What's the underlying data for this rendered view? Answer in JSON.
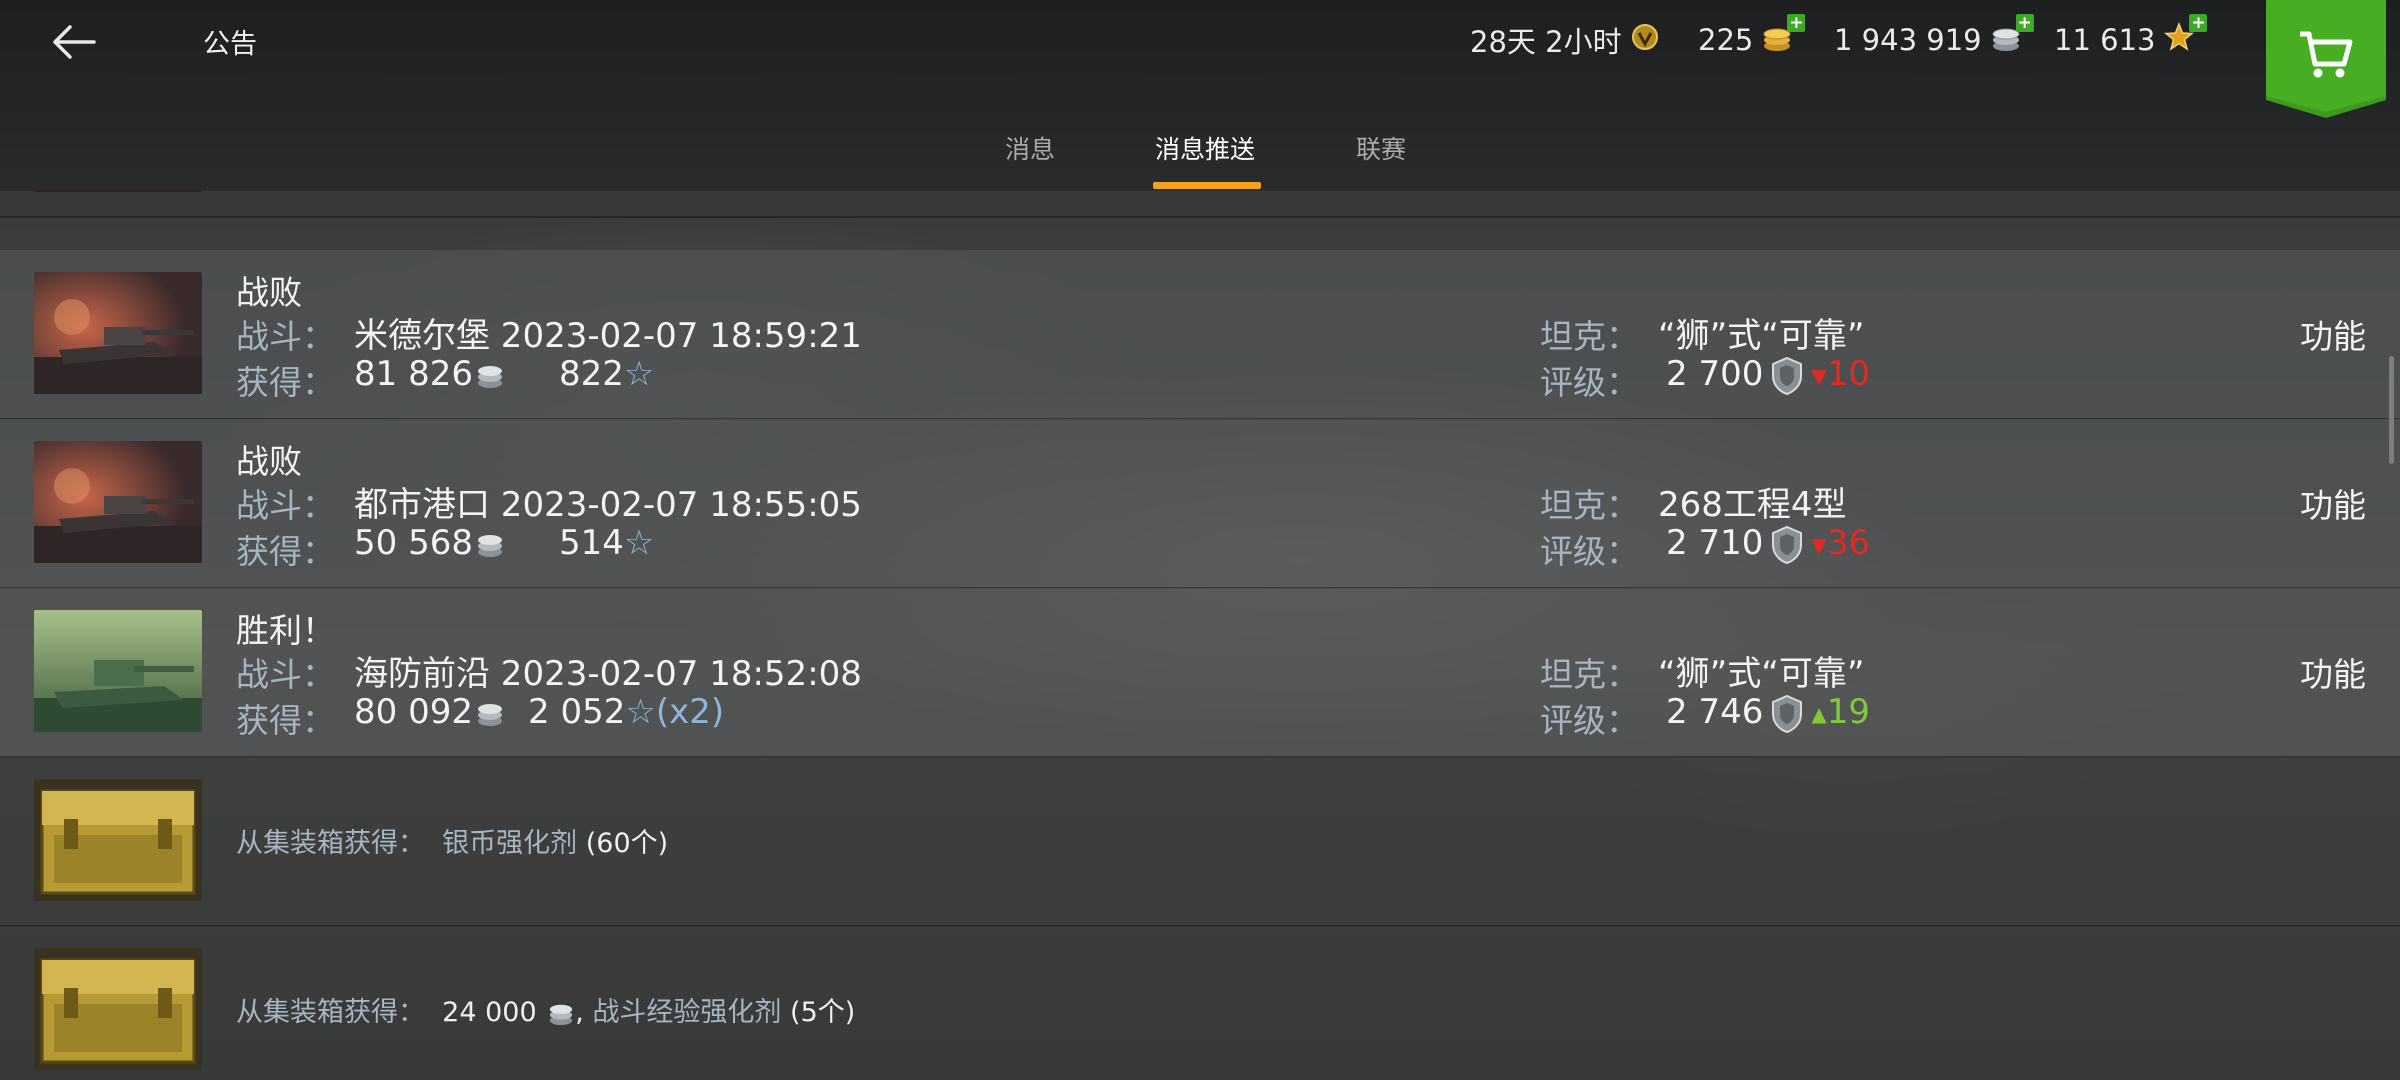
{
  "header": {
    "title": "公告",
    "premium_time": "28天 2小时",
    "gold": "225",
    "silver": "1 943 919",
    "free_xp": "11 613",
    "colors": {
      "accent": "#f5a11d",
      "shop_green": "#3c9a1c"
    }
  },
  "tabs": [
    {
      "label": "消息",
      "active": false
    },
    {
      "label": "消息推送",
      "active": true
    },
    {
      "label": "联赛",
      "active": false
    }
  ],
  "battles": [
    {
      "result": "战败",
      "battle_label": "战斗：",
      "battle": "米德尔堡 2023-02-07 18:59:21",
      "earned_label": "获得：",
      "credits": "81 826",
      "xp": "822",
      "xp_multiplier": "",
      "tank_label": "坦克：",
      "tank": "“狮”式“可靠”",
      "rating_label": "评级：",
      "rating": "2 700",
      "rating_change": "10",
      "rating_direction": "down",
      "action": "功能",
      "thumb": "burning-tank"
    },
    {
      "result": "战败",
      "battle_label": "战斗：",
      "battle": "都市港口 2023-02-07 18:55:05",
      "earned_label": "获得：",
      "credits": "50 568",
      "xp": "514",
      "xp_multiplier": "",
      "tank_label": "坦克：",
      "tank": "268工程4型",
      "rating_label": "评级：",
      "rating": "2 710",
      "rating_change": "36",
      "rating_direction": "down",
      "action": "功能",
      "thumb": "burning-tank"
    },
    {
      "result": "胜利！",
      "battle_label": "战斗：",
      "battle": "海防前沿 2023-02-07 18:52:08",
      "earned_label": "获得：",
      "credits": "80 092",
      "xp": "2 052",
      "xp_multiplier": "(x2)",
      "tank_label": "坦克：",
      "tank": "“狮”式“可靠”",
      "rating_label": "评级：",
      "rating": "2 746",
      "rating_change": "19",
      "rating_direction": "up",
      "action": "功能",
      "thumb": "green-tank"
    }
  ],
  "crates": [
    {
      "label": "从集装箱获得：",
      "item": "银币强化剂",
      "count": "(60个)"
    },
    {
      "label": "从集装箱获得：",
      "credits": "24 000",
      "separator": ",",
      "item": "战斗经验强化剂",
      "count": "(5个)"
    }
  ],
  "star_glyph": "☆"
}
